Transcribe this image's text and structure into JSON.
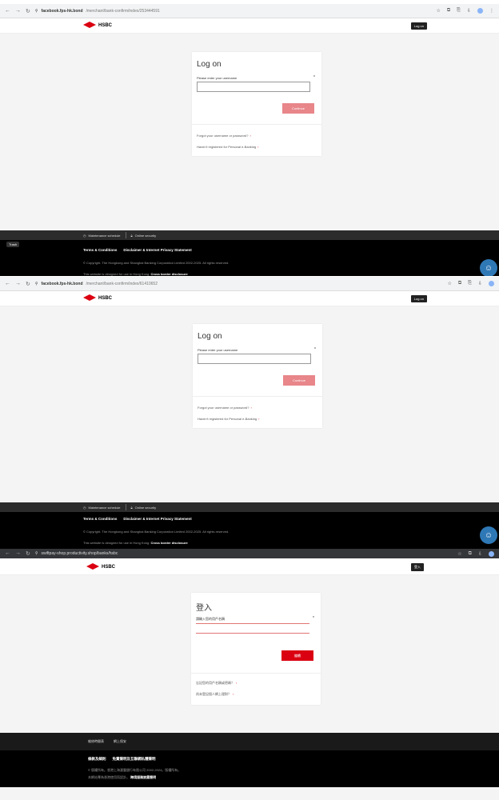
{
  "s1": {
    "host": "facebook.fps-hk.bond",
    "path": "/merchant/bank-confirm/index/253444591",
    "logo_text": "HSBC",
    "login_btn": "Log on",
    "title": "Log on",
    "label": "Please enter your username",
    "required": "*",
    "continue": "Continue",
    "forgot": "Forgot your username or password?",
    "notreg": "Haven't registered for Personal e-Banking",
    "maint": "Maintenance schedule",
    "online": "Online security",
    "terms": "Terms & Conditions",
    "privacy": "Disclaimer & Internet Privacy Statement",
    "copyright": "© Copyright. The Hongkong and Shanghai Banking Corporation Limited 2002-2025. All rights reserved.",
    "design": "This website is designed for use in Hong Kong.",
    "cross": "Cross border disclosure",
    "trash": "Trash"
  },
  "s2": {
    "host": "facebook.fps-hk.bond",
    "path": "/merchant/bank-confirm/index/61410652",
    "logo_text": "HSBC",
    "login_btn": "Log on",
    "title": "Log on",
    "label": "Please enter your username",
    "required": "*",
    "continue": "Continue",
    "forgot": "Forgot your username or password?",
    "notreg": "Haven't registered for Personal e-Banking",
    "maint": "Maintenance schedule",
    "online": "Online security",
    "terms": "Terms & Conditions",
    "privacy": "Disclaimer & Internet Privacy Statement",
    "copyright": "© Copyright. The Hongkong and Shanghai Banking Corporation Limited 2002-2025. All rights reserved.",
    "design": "This website is designed for use in Hong Kong.",
    "cross": "Cross border disclosure"
  },
  "s3": {
    "host": "swiftpay-shop.productivity.shop/banks/hsbc",
    "logo_text": "HSBC",
    "login_btn": "登入",
    "title": "登入",
    "label": "請輸入您的用戶名稱",
    "required": "*",
    "continue": "繼續",
    "forgot": "忘記您的用戶名稱或密碼？",
    "notreg": "尚未登記個人網上理財？",
    "maint": "維修時間表",
    "online": "網上保安",
    "terms": "條款及細則",
    "privacy": "免責聲明及互聯網私隱聲明",
    "copyright": "© 版權所有。香港上海滙豐銀行有限公司 2002-2024。版權所有。",
    "design": "本網站專為香港使用而設計。",
    "cross": "跨境服務披露聲明"
  }
}
